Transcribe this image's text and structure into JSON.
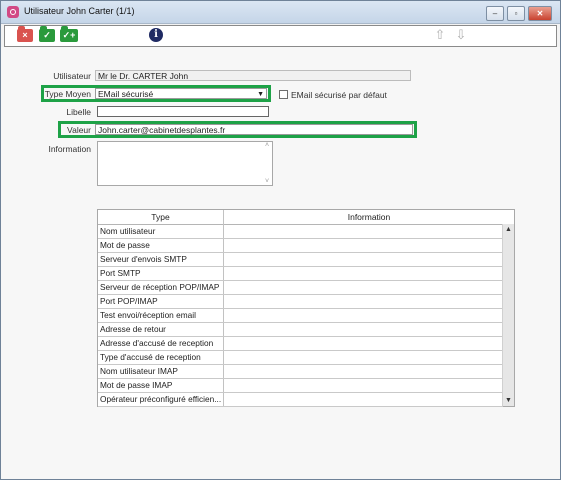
{
  "window": {
    "title": "Utilisateur John Carter (1/1)",
    "minimize": "–",
    "maximize": "▫",
    "close": "✕"
  },
  "toolbar": {
    "icons": [
      "folder-delete-icon",
      "folder-check-icon",
      "folder-check-plus-icon",
      "info-icon",
      "arrow-up-icon",
      "arrow-down-icon"
    ],
    "delete_mark": "×",
    "save_mark": "✓",
    "save_new_mark": "✓+",
    "info_mark": "i",
    "up_mark": "⇧",
    "down_mark": "⇩"
  },
  "form": {
    "utilisateur_label": "Utilisateur",
    "utilisateur_value": "Mr le Dr. CARTER John",
    "type_moyen_label": "Type Moyen",
    "type_moyen_value": "EMail sécurisé",
    "default_checkbox_label": "EMail sécurisé par défaut",
    "libelle_label": "Libelle",
    "libelle_value": "",
    "valeur_label": "Valeur",
    "valeur_value": "John.carter@cabinetdesplantes.fr",
    "information_label": "Information",
    "highlight_color": "#1ea247"
  },
  "grid": {
    "columns": [
      "Type",
      "Information"
    ],
    "rows": [
      [
        "Nom utilisateur",
        ""
      ],
      [
        "Mot de passe",
        ""
      ],
      [
        "Serveur d'envois SMTP",
        ""
      ],
      [
        "Port SMTP",
        ""
      ],
      [
        "Serveur de réception POP/IMAP",
        ""
      ],
      [
        "Port POP/IMAP",
        ""
      ],
      [
        "Test envoi/réception email",
        ""
      ],
      [
        "Adresse de retour",
        ""
      ],
      [
        "Adresse d'accusé de reception",
        ""
      ],
      [
        "Type d'accusé de reception",
        ""
      ],
      [
        "Nom utilisateur IMAP",
        ""
      ],
      [
        "Mot de passe IMAP",
        ""
      ],
      [
        "Opérateur préconfiguré efficien...",
        ""
      ]
    ],
    "scroll_up": "▲",
    "scroll_down": "▼"
  }
}
